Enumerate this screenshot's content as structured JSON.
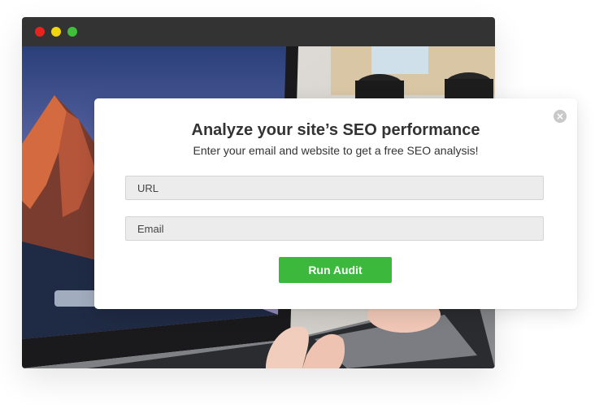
{
  "browser": {
    "window_controls": [
      "close",
      "minimize",
      "maximize"
    ]
  },
  "modal": {
    "title": "Analyze your site’s SEO performance",
    "subtitle": "Enter your email and website to get a free SEO analysis!",
    "close_icon": "close-icon",
    "url_placeholder": "URL",
    "email_placeholder": "Email",
    "url_value": "",
    "email_value": "",
    "submit_label": "Run Audit"
  },
  "colors": {
    "titlebar": "#333333",
    "dot_red": "#e52420",
    "dot_yellow": "#f2d60c",
    "dot_green": "#3fbf3a",
    "button": "#3cb93c",
    "input_bg": "#ececec",
    "text": "#333333"
  }
}
